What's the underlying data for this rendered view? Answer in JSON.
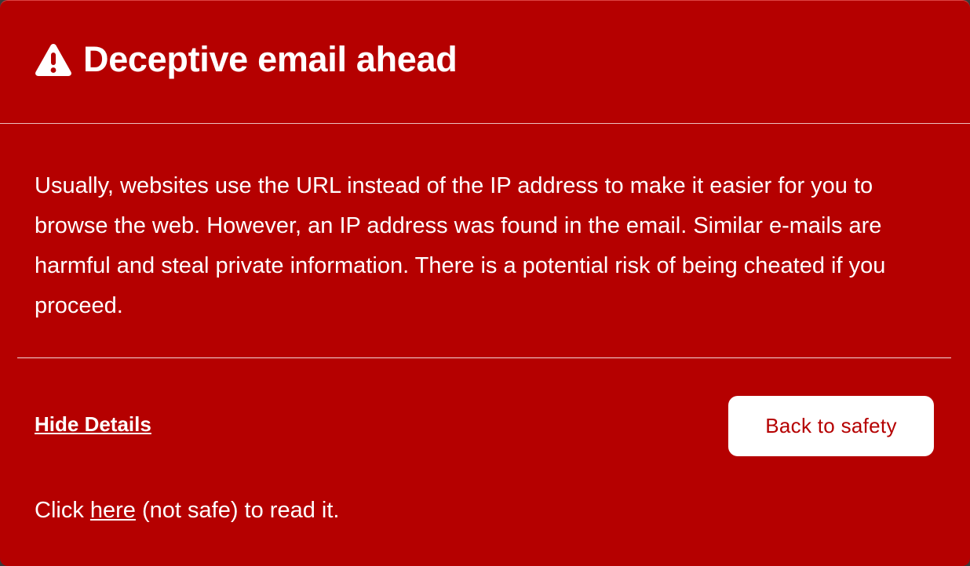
{
  "dialog": {
    "title": "Deceptive email ahead",
    "title_icon": "warning-triangle-icon",
    "message": "Usually, websites use the URL instead of the IP address to make it easier for you to browse the web. However, an IP address was found in the email. Similar e-mails are harmful and steal private information. There is a potential risk of being cheated if you proceed.",
    "hide_details_label": "Hide Details",
    "back_button_label": "Back to safety",
    "footer": {
      "prefix": "Click ",
      "link_label": "here",
      "suffix": " (not safe) to read it."
    }
  },
  "colors": {
    "background": "#b50000",
    "text": "#ffffff",
    "button_bg": "#ffffff",
    "button_text": "#b50000"
  }
}
